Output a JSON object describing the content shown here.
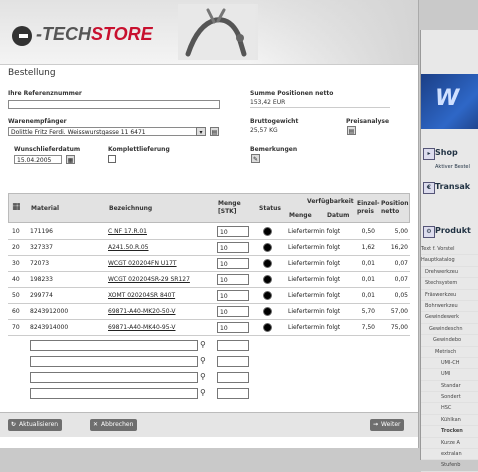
{
  "brand": {
    "prefix": "-TECH",
    "highlight": "STORE"
  },
  "page_title": "Bestellung",
  "form": {
    "ref_label": "Ihre Referenznummer",
    "ref_value": "",
    "receiver_label": "Warenempfänger",
    "receiver_value": "Dolittle Fritz Ferdi. Weisswurstgasse 11 6471",
    "wish_date_label": "Wunschlieferdatum",
    "wish_date_value": "15.04.2005",
    "complete_label": "Komplettlieferung",
    "sum_label": "Summe Positionen netto",
    "sum_value": "153,42 EUR",
    "weight_label": "Bruttogewicht",
    "weight_value": "25,57 KG",
    "price_label": "Preisanalyse",
    "remarks_label": "Bemerkungen"
  },
  "table": {
    "headers": {
      "material": "Material",
      "bezeichnung": "Bezeichnung",
      "menge_1": "Menge",
      "menge_2": "[STK]",
      "status": "Status",
      "verfug": "Verfügbarkeit",
      "menge_sub": "Menge",
      "datum_sub": "Datum",
      "ep_1": "Einzel-",
      "ep_2": "preis",
      "pn_1": "Position",
      "pn_2": "netto"
    },
    "rows": [
      {
        "pos": "10",
        "material": "171196",
        "bez": "C NF 17.R.01",
        "qty": "10",
        "avail": "Liefertermin folgt",
        "ep": "0,50",
        "pn": "5,00"
      },
      {
        "pos": "20",
        "material": "327337",
        "bez": "A241.50.R.05",
        "qty": "10",
        "avail": "Liefertermin folgt",
        "ep": "1,62",
        "pn": "16,20"
      },
      {
        "pos": "30",
        "material": "72073",
        "bez": "WCGT 020204FN U17T",
        "qty": "10",
        "avail": "Liefertermin folgt",
        "ep": "0,01",
        "pn": "0,07"
      },
      {
        "pos": "40",
        "material": "198233",
        "bez": "WCGT 020204SR-29 SR127",
        "qty": "10",
        "avail": "Liefertermin folgt",
        "ep": "0,01",
        "pn": "0,07"
      },
      {
        "pos": "50",
        "material": "299774",
        "bez": "XOMT 020204SR 840T",
        "qty": "10",
        "avail": "Liefertermin folgt",
        "ep": "0,01",
        "pn": "0,05"
      },
      {
        "pos": "60",
        "material": "8243912000",
        "bez": "69871-A40-MK20-50-V",
        "qty": "10",
        "avail": "Liefertermin folgt",
        "ep": "5,70",
        "pn": "57,00"
      },
      {
        "pos": "70",
        "material": "8243914000",
        "bez": "69871-A40-MK40-95-V",
        "qty": "10",
        "avail": "Liefertermin folgt",
        "ep": "7,50",
        "pn": "75,00"
      }
    ]
  },
  "footer": {
    "refresh": "Aktualisieren",
    "cancel": "Abbrechen",
    "next": "Weiter"
  },
  "bg_window": {
    "nav": [
      "Shop",
      "Aktiver Bestel",
      "Transak",
      "Produkt"
    ],
    "tree": [
      "Text f. Vorstel",
      "Hauptkatalog",
      "Drehwerkzeu",
      "Stechsystem",
      "Fräswerkzeu",
      "Bohrwerkzeu",
      "Gewindewerk",
      "Gewindeschn",
      "Gewindebo",
      "Metrisch",
      "UMI-CH",
      "UMI",
      "Standar",
      "Sondert",
      "HSC",
      "Kühlkan",
      "Trocken",
      "Kurze A",
      "extralan",
      "Stufenb"
    ]
  },
  "colors": {
    "brand_red": "#c8102e",
    "status_dot": "#000000",
    "header_gray": "#e2e2e2"
  }
}
